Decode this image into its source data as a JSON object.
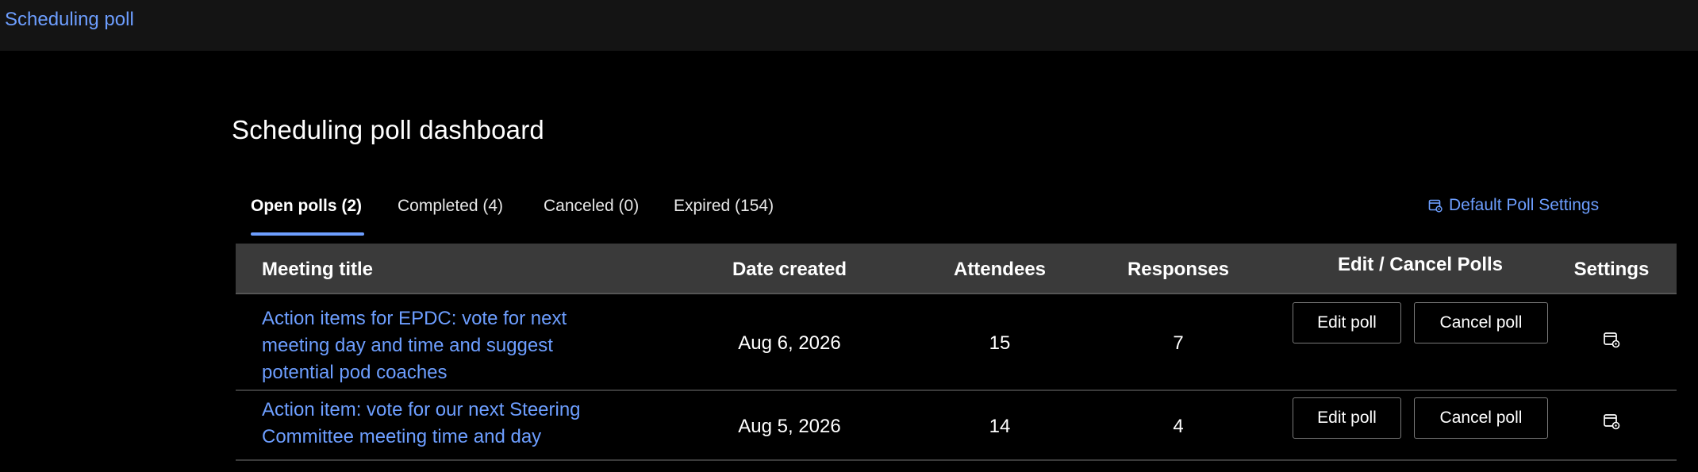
{
  "header": {
    "app_title": "Scheduling poll"
  },
  "page": {
    "title": "Scheduling poll dashboard"
  },
  "tabs": [
    {
      "label": "Open polls (2)",
      "active": true
    },
    {
      "label": "Completed (4)",
      "active": false
    },
    {
      "label": "Canceled (0)",
      "active": false
    },
    {
      "label": "Expired (154)",
      "active": false
    }
  ],
  "default_settings": {
    "label": "Default Poll Settings",
    "icon": "calendar-settings-icon"
  },
  "table": {
    "columns": [
      "Meeting title",
      "Date created",
      "Attendees",
      "Responses",
      "Edit / Cancel Polls",
      "Settings"
    ],
    "rows": [
      {
        "title": "Action items for EPDC: vote for next meeting day and time and suggest potential pod coaches",
        "date_created": "Aug 6, 2026",
        "attendees": "15",
        "responses": "7",
        "edit_label": "Edit poll",
        "cancel_label": "Cancel poll",
        "settings_icon": "calendar-settings-icon"
      },
      {
        "title": "Action item: vote for our next Steering Committee meeting time and day",
        "date_created": "Aug 5, 2026",
        "attendees": "14",
        "responses": "4",
        "edit_label": "Edit poll",
        "cancel_label": "Cancel poll",
        "settings_icon": "calendar-settings-icon"
      }
    ]
  },
  "colors": {
    "background": "#000000",
    "topbar": "#141414",
    "accent": "#6d9eff",
    "table_header": "#3a3a3a"
  }
}
